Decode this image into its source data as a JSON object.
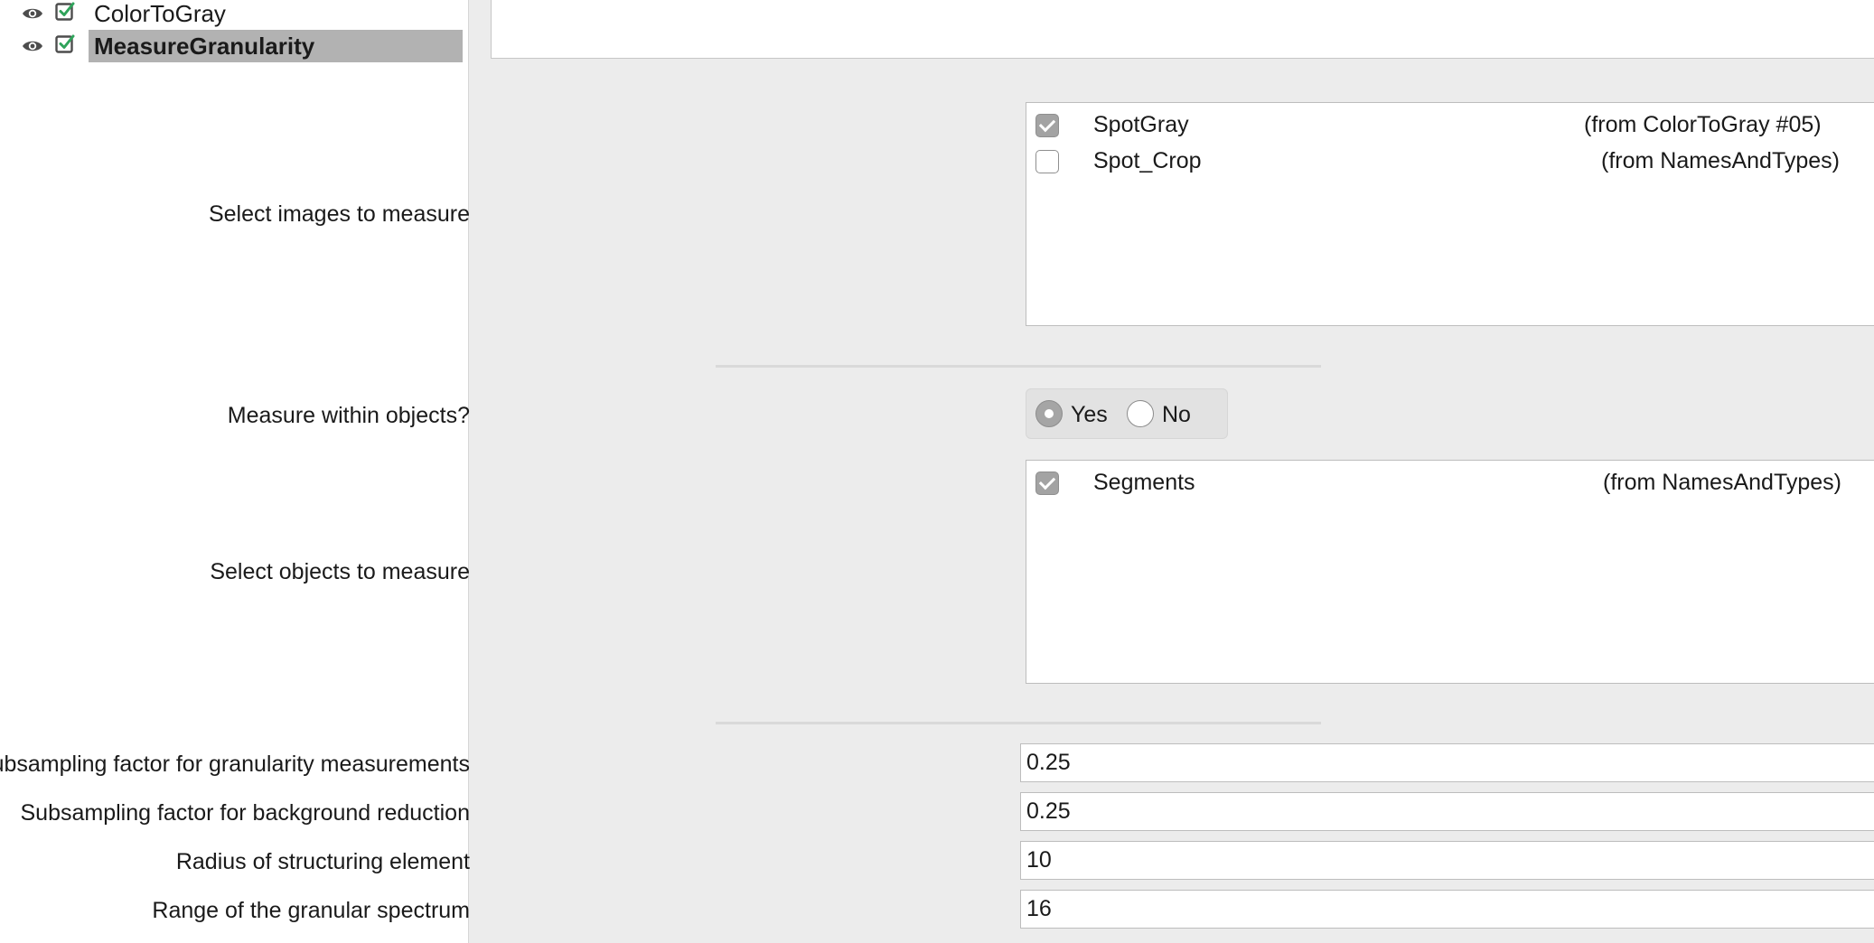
{
  "pipeline": {
    "modules": [
      {
        "name": "ColorToGray",
        "selected": false
      },
      {
        "name": "MeasureGranularity",
        "selected": true
      }
    ]
  },
  "settings": {
    "images": {
      "label": "Select images to measure",
      "items": [
        {
          "name": "SpotGray",
          "source": "(from ColorToGray #05)",
          "checked": true
        },
        {
          "name": "Spot_Crop",
          "source": "(from NamesAndTypes)",
          "checked": false
        }
      ]
    },
    "within_objects": {
      "label": "Measure within objects?",
      "options": [
        "Yes",
        "No"
      ],
      "selected": "Yes"
    },
    "objects": {
      "label": "Select objects to measure",
      "items": [
        {
          "name": "Segments",
          "source": "(from NamesAndTypes)",
          "checked": true
        }
      ]
    },
    "fields": [
      {
        "label": "Subsampling factor for granularity measurements",
        "value": "0.25"
      },
      {
        "label": "Subsampling factor for background reduction",
        "value": "0.25"
      },
      {
        "label": "Radius of structuring element",
        "value": "10"
      },
      {
        "label": "Range of the granular spectrum",
        "value": "16"
      }
    ]
  },
  "colors": {
    "selection": "#b2b2b2",
    "panel_background": "#ececec",
    "checkbox_checked": "#a3a3a3",
    "eye_icon": "#4d4d4d",
    "check_icon_border": "#4d4d4d",
    "check_icon_tick": "#2fa35a"
  }
}
